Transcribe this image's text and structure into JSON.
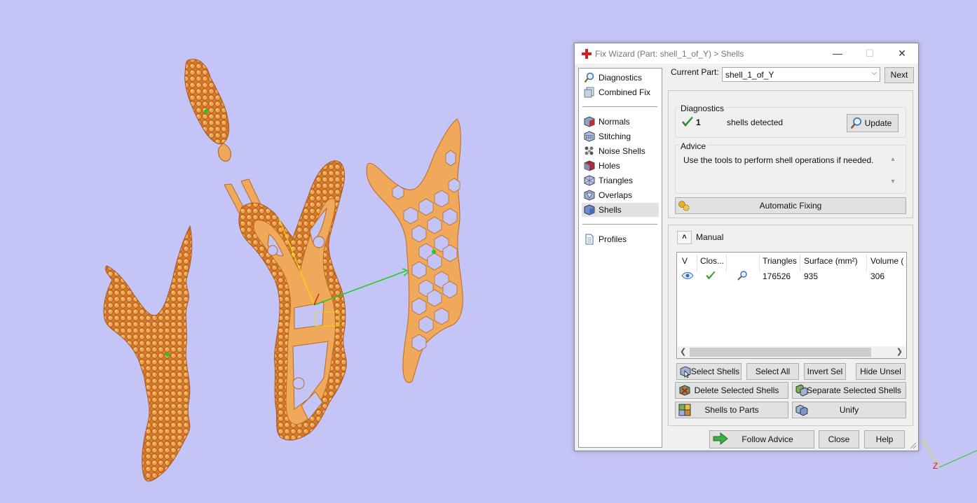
{
  "window": {
    "title": "Fix Wizard (Part: shell_1_of_Y) > Shells",
    "app_icon": "red-cross-icon",
    "controls": {
      "minimize": "—",
      "maximize": "☐",
      "close": "✕"
    }
  },
  "nav": {
    "group1": [
      {
        "label": "Diagnostics",
        "icon": "magnifier-icon"
      },
      {
        "label": "Combined Fix",
        "icon": "combined-fix-icon"
      }
    ],
    "group2": [
      {
        "label": "Normals",
        "icon": "normals-icon"
      },
      {
        "label": "Stitching",
        "icon": "stitching-icon"
      },
      {
        "label": "Noise Shells",
        "icon": "noise-shells-icon"
      },
      {
        "label": "Holes",
        "icon": "holes-icon"
      },
      {
        "label": "Triangles",
        "icon": "triangles-icon"
      },
      {
        "label": "Overlaps",
        "icon": "overlaps-icon"
      },
      {
        "label": "Shells",
        "icon": "shells-icon",
        "selected": true
      }
    ],
    "group3": [
      {
        "label": "Profiles",
        "icon": "document-icon"
      }
    ]
  },
  "current_part": {
    "label": "Current Part:",
    "value": "shell_1_of_Y",
    "next_label": "Next"
  },
  "diagnostics": {
    "heading": "Diagnostics",
    "count": "1",
    "text": "shells detected",
    "update_label": "Update"
  },
  "advice": {
    "heading": "Advice",
    "text": "Use the tools to perform shell operations if needed.",
    "automatic_fixing_label": "Automatic Fixing"
  },
  "manual": {
    "heading": "Manual",
    "columns": [
      "V",
      "Clos...",
      "",
      "Triangles",
      "Surface (mm²)",
      "Volume ("
    ],
    "rows": [
      {
        "triangles": "176526",
        "surface": "935",
        "volume": "306"
      }
    ],
    "buttons": {
      "select_shells": "Select Shells",
      "select_all": "Select All",
      "invert_sel": "Invert Sel",
      "hide_unsel": "Hide Unsel",
      "delete_selected_shells": "Delete Selected Shells",
      "separate_selected_shells": "Separate Selected Shells",
      "shells_to_parts": "Shells to Parts",
      "unify": "Unify"
    }
  },
  "footer": {
    "follow_advice": "Follow Advice",
    "close": "Close",
    "help": "Help"
  },
  "colors": {
    "background": "#c4c4f6",
    "part_fill": "#f0a95a",
    "part_dark": "#c76a1e",
    "axis_green": "#22cc22",
    "axis_yellow": "#e8e000",
    "axis_red": "#cc2222"
  },
  "viewport": {
    "axis_label": "Z"
  }
}
